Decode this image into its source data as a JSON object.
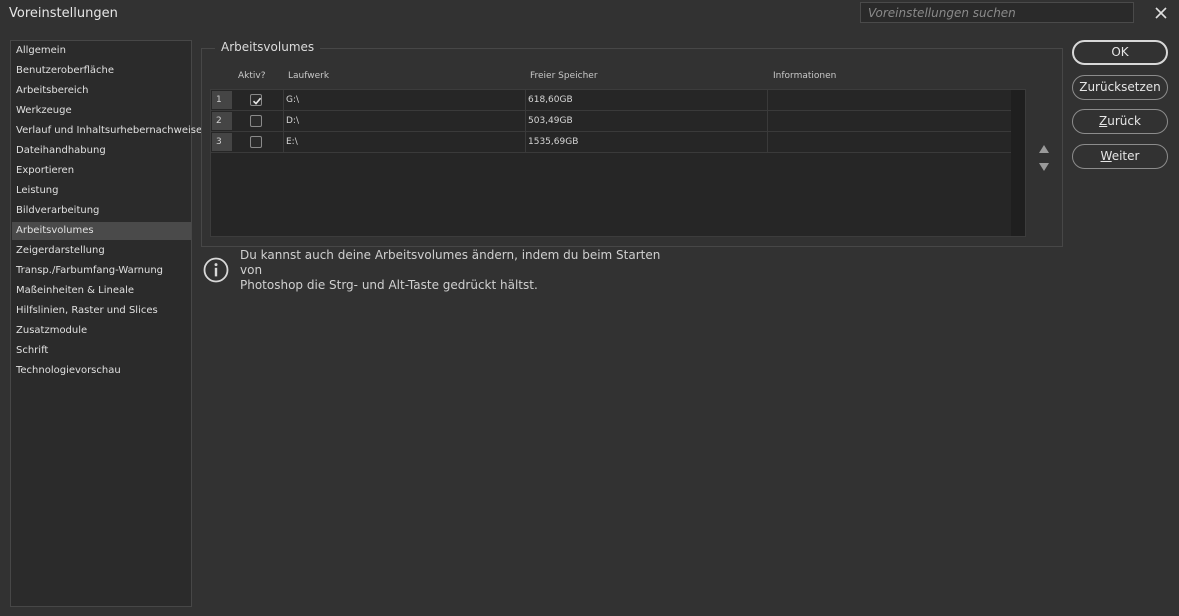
{
  "window": {
    "title": "Voreinstellungen"
  },
  "search": {
    "placeholder": "Voreinstellungen suchen"
  },
  "sidebar": {
    "items": [
      {
        "label": "Allgemein"
      },
      {
        "label": "Benutzeroberfläche"
      },
      {
        "label": "Arbeitsbereich"
      },
      {
        "label": "Werkzeuge"
      },
      {
        "label": "Verlauf und Inhaltsurhebernachweise"
      },
      {
        "label": "Dateihandhabung"
      },
      {
        "label": "Exportieren"
      },
      {
        "label": "Leistung"
      },
      {
        "label": "Bildverarbeitung"
      },
      {
        "label": "Arbeitsvolumes"
      },
      {
        "label": "Zeigerdarstellung"
      },
      {
        "label": "Transp./Farbumfang-Warnung"
      },
      {
        "label": "Maßeinheiten & Lineale"
      },
      {
        "label": "Hilfslinien, Raster und Slices"
      },
      {
        "label": "Zusatzmodule"
      },
      {
        "label": "Schrift"
      },
      {
        "label": "Technologievorschau"
      }
    ],
    "active": "Arbeitsvolumes"
  },
  "panel": {
    "title": "Arbeitsvolumes",
    "columns": {
      "aktiv": "Aktiv?",
      "laufwerk": "Laufwerk",
      "frei": "Freier Speicher",
      "info": "Informationen"
    },
    "rows": [
      {
        "num": "1",
        "checked": true,
        "drive": "G:\\",
        "free": "618,60GB",
        "info": ""
      },
      {
        "num": "2",
        "checked": false,
        "drive": "D:\\",
        "free": "503,49GB",
        "info": ""
      },
      {
        "num": "3",
        "checked": false,
        "drive": "E:\\",
        "free": "1535,69GB",
        "info": ""
      }
    ],
    "info_line1": "Du kannst auch deine Arbeitsvolumes ändern, indem du beim Starten von",
    "info_line2": "Photoshop die Strg- und Alt-Taste gedrückt hältst."
  },
  "buttons": {
    "ok": "OK",
    "reset": "Zurücksetzen",
    "back": "Zurück",
    "next": "Weiter"
  },
  "icons": {
    "close": "close-icon",
    "info": "info-icon",
    "up": "move-up-icon",
    "down": "move-down-icon",
    "check": "checkmark-icon"
  },
  "colors": {
    "background": "#323232",
    "sidebar_bg": "#2b2b2b",
    "active_item": "#4a4a4a",
    "table_bg": "#262626"
  }
}
